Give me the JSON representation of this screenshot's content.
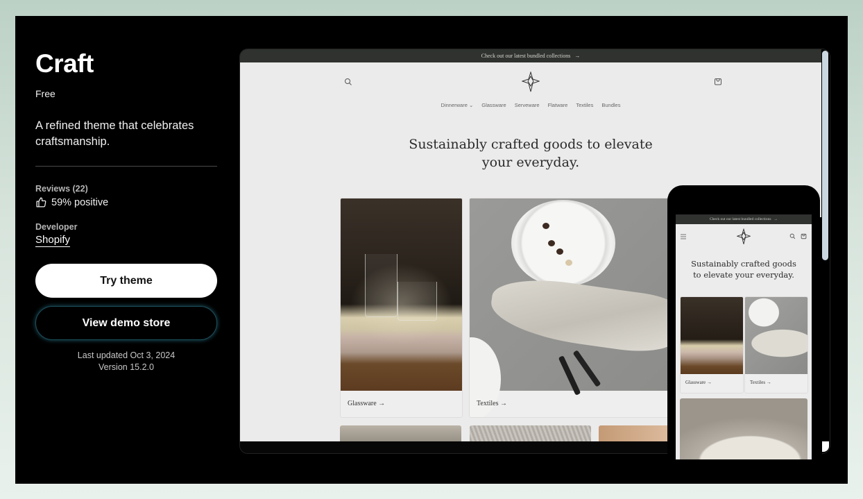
{
  "theme": {
    "name": "Craft",
    "price": "Free",
    "tagline": "A refined theme that celebrates craftsmanship.",
    "reviews_label": "Reviews (22)",
    "reviews_value": "59% positive",
    "reviews_icon": "thumbs-up-icon",
    "developer_label": "Developer",
    "developer_name": "Shopify",
    "try_button": "Try theme",
    "demo_button": "View demo store",
    "last_updated": "Last updated Oct 3, 2024",
    "version": "Version 15.2.0"
  },
  "preview": {
    "announcement": "Check out our latest bundled collections",
    "announcement_arrow": "→",
    "nav": [
      "Dinnerware ⌄",
      "Glassware",
      "Serveware",
      "Flatware",
      "Textiles",
      "Bundles"
    ],
    "hero_line1": "Sustainably crafted goods to elevate",
    "hero_line2": "your everyday.",
    "cards": [
      {
        "label": "Glassware →"
      },
      {
        "label": "Textiles →"
      }
    ]
  },
  "mobile": {
    "announcement": "Check out our latest bundled collections",
    "announcement_arrow": "→",
    "hero_line1": "Sustainably crafted goods",
    "hero_line2": "to elevate your everyday.",
    "cards": [
      {
        "label": "Glassware →"
      },
      {
        "label": "Textiles →"
      }
    ]
  },
  "colors": {
    "background_top": "#bcd1c6",
    "panel": "#000000",
    "announcement_bar": "#2f322f",
    "store_bg": "#ecebeb",
    "demo_button_glow": "#1d4f5c",
    "scrollbar_thumb": "#cad7e0"
  }
}
